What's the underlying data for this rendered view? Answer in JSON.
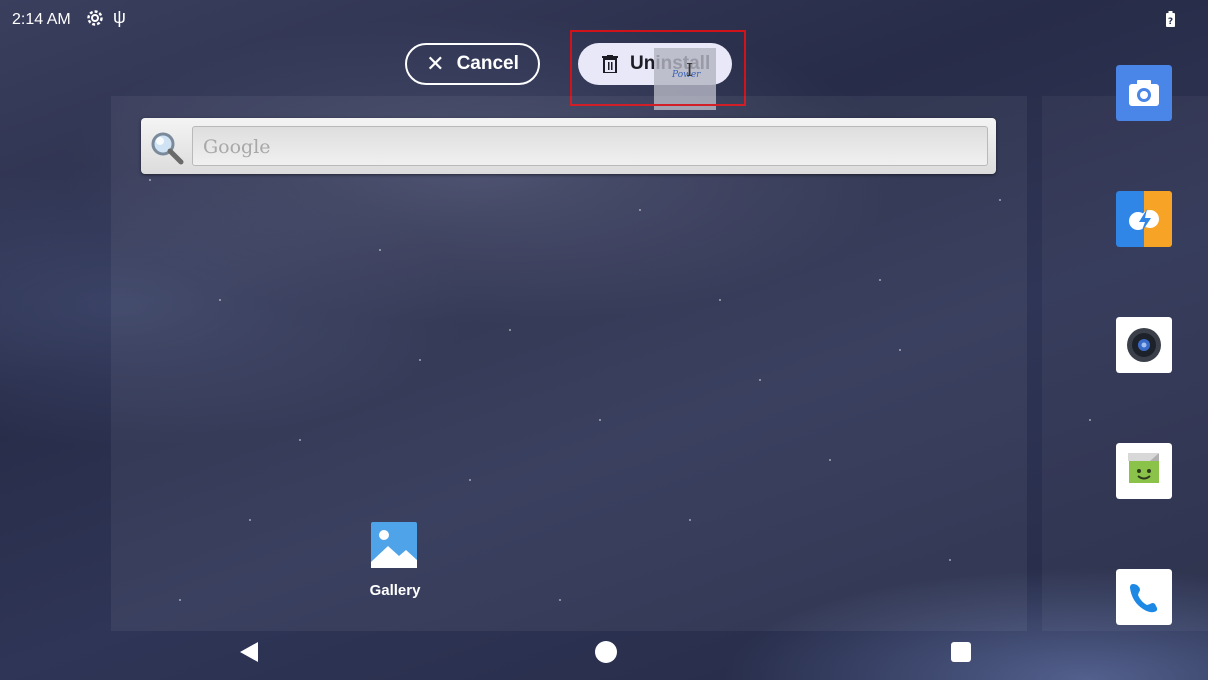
{
  "status_bar": {
    "time": "2:14 AM",
    "icons": [
      "settings-gear-icon",
      "usb-icon",
      "battery-icon"
    ]
  },
  "drop_target_bar": {
    "cancel_label": "Cancel",
    "uninstall_label": "Uninstall",
    "dragged_item_text": "Power"
  },
  "search": {
    "placeholder": "Google"
  },
  "workspace": {
    "apps": [
      {
        "label": "Gallery",
        "icon": "gallery-icon"
      }
    ]
  },
  "dock": {
    "apps": [
      "camera-icon",
      "flash-share-icon",
      "music-speaker-icon",
      "messaging-icon",
      "phone-icon"
    ]
  },
  "navigation": {
    "buttons": [
      "back-icon",
      "home-icon",
      "recents-icon"
    ]
  },
  "colors": {
    "highlight": "#d0121b",
    "camera_blue": "#4a85e8",
    "phone_blue": "#1e88e5",
    "messaging_green": "#8bc34a"
  }
}
